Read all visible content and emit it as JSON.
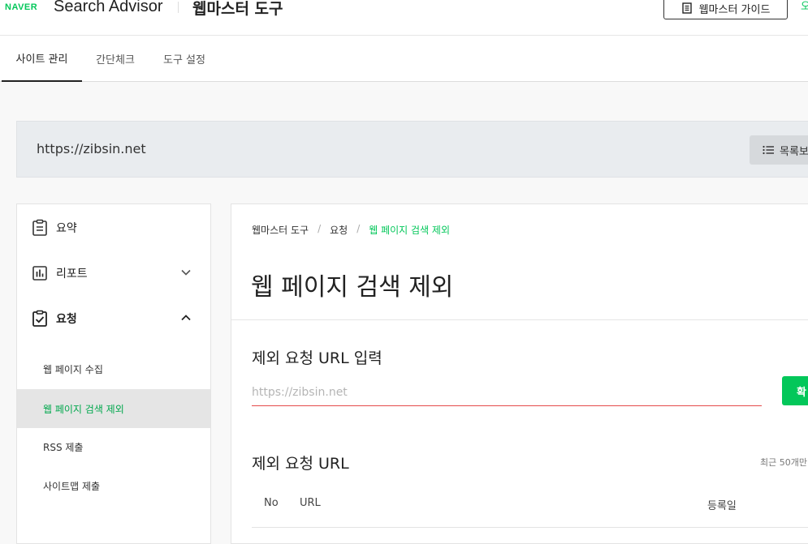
{
  "header": {
    "naver_logo": "NAVER",
    "product": "Search Advisor",
    "tool_title": "웹마스터 도구",
    "guide_button": "웹마스터 가이드",
    "edge_text": "오"
  },
  "tabs": [
    {
      "label": "사이트 관리",
      "active": true
    },
    {
      "label": "간단체크",
      "active": false
    },
    {
      "label": "도구 설정",
      "active": false
    }
  ],
  "site": {
    "url": "https://zibsin.net",
    "list_button": "목록보"
  },
  "sidebar": {
    "items": [
      {
        "label": "요약",
        "icon": "clipboard-icon"
      },
      {
        "label": "리포트",
        "icon": "chart-icon",
        "expanded": false
      },
      {
        "label": "요청",
        "icon": "checklist-icon",
        "expanded": true
      }
    ],
    "sub_items": [
      {
        "label": "웹 페이지 수집",
        "active": false
      },
      {
        "label": "웹 페이지 검색 제외",
        "active": true
      },
      {
        "label": "RSS 제출",
        "active": false
      },
      {
        "label": "사이트맵 제출",
        "active": false
      }
    ]
  },
  "main": {
    "breadcrumb": [
      "웹마스터 도구",
      "요청",
      "웹 페이지 검색 제외"
    ],
    "title": "웹 페이지 검색 제외",
    "input_section_title": "제외 요청 URL 입력",
    "input_placeholder": "https://zibsin.net",
    "input_value": "",
    "confirm_button": "확",
    "list_section_title": "제외 요청 URL",
    "recent_note": "최근 50개만",
    "table_headers": {
      "no": "No",
      "url": "URL",
      "date": "등록일"
    }
  },
  "colors": {
    "brand_green": "#03c75a",
    "error_underline": "#e54b4b"
  }
}
